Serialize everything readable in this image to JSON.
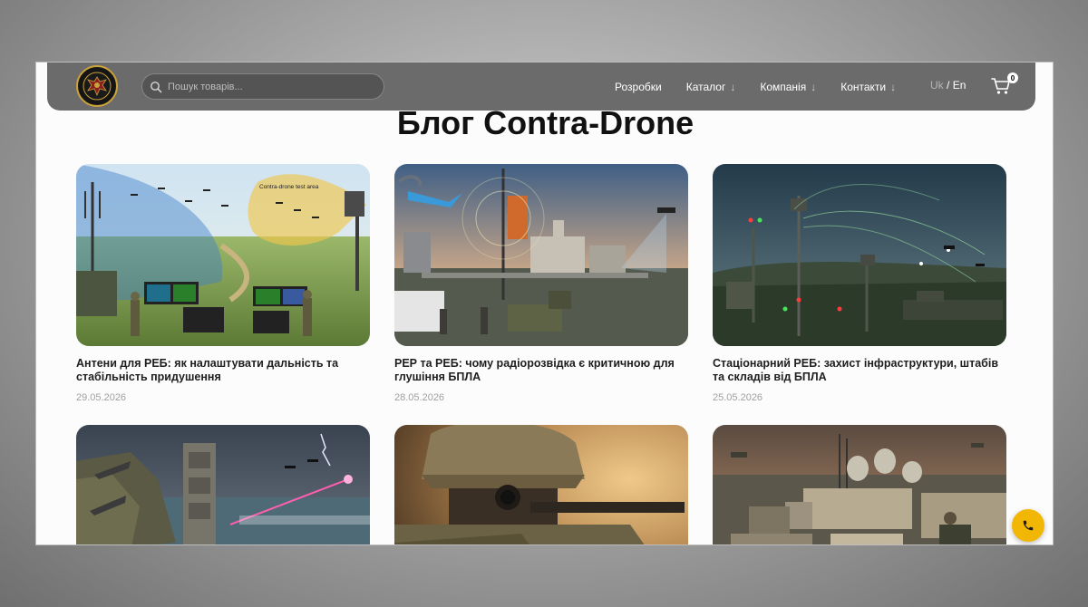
{
  "header": {
    "search_placeholder": "Пошук товарів...",
    "nav": [
      {
        "label": "Розробки",
        "has_dropdown": false
      },
      {
        "label": "Каталог",
        "has_dropdown": true
      },
      {
        "label": "Компанія",
        "has_dropdown": true
      },
      {
        "label": "Контакти",
        "has_dropdown": true
      }
    ],
    "dropdown_arrow": "↓",
    "lang_uk": "Uk",
    "lang_separator": "/",
    "lang_en": "En",
    "cart_count": "0"
  },
  "page_title": "Блог Contra-Drone",
  "posts": [
    {
      "title": "Антени для РЕБ: як налаштувати дальність та стабільність придушення",
      "date": "29.05.2026",
      "image_text": "Contra-drone test area"
    },
    {
      "title": "РЕР та РЕБ: чому радіорозвідка є критичною для глушіння БПЛА",
      "date": "28.05.2026"
    },
    {
      "title": "Стаціонарний РЕБ: захист інфраструктури, штабів та складів від БПЛА",
      "date": "25.05.2026"
    },
    {
      "title": "",
      "date": ""
    },
    {
      "title": "",
      "date": ""
    },
    {
      "title": "",
      "date": ""
    }
  ],
  "colors": {
    "navbar": "#6b6b6b",
    "accent_phone": "#f2b705",
    "title_text": "#111111",
    "date_text": "#a0a0a0"
  },
  "icons": {
    "search": "search-icon",
    "cart": "cart-icon",
    "phone": "phone-icon",
    "logo": "eagle-emblem-icon"
  }
}
